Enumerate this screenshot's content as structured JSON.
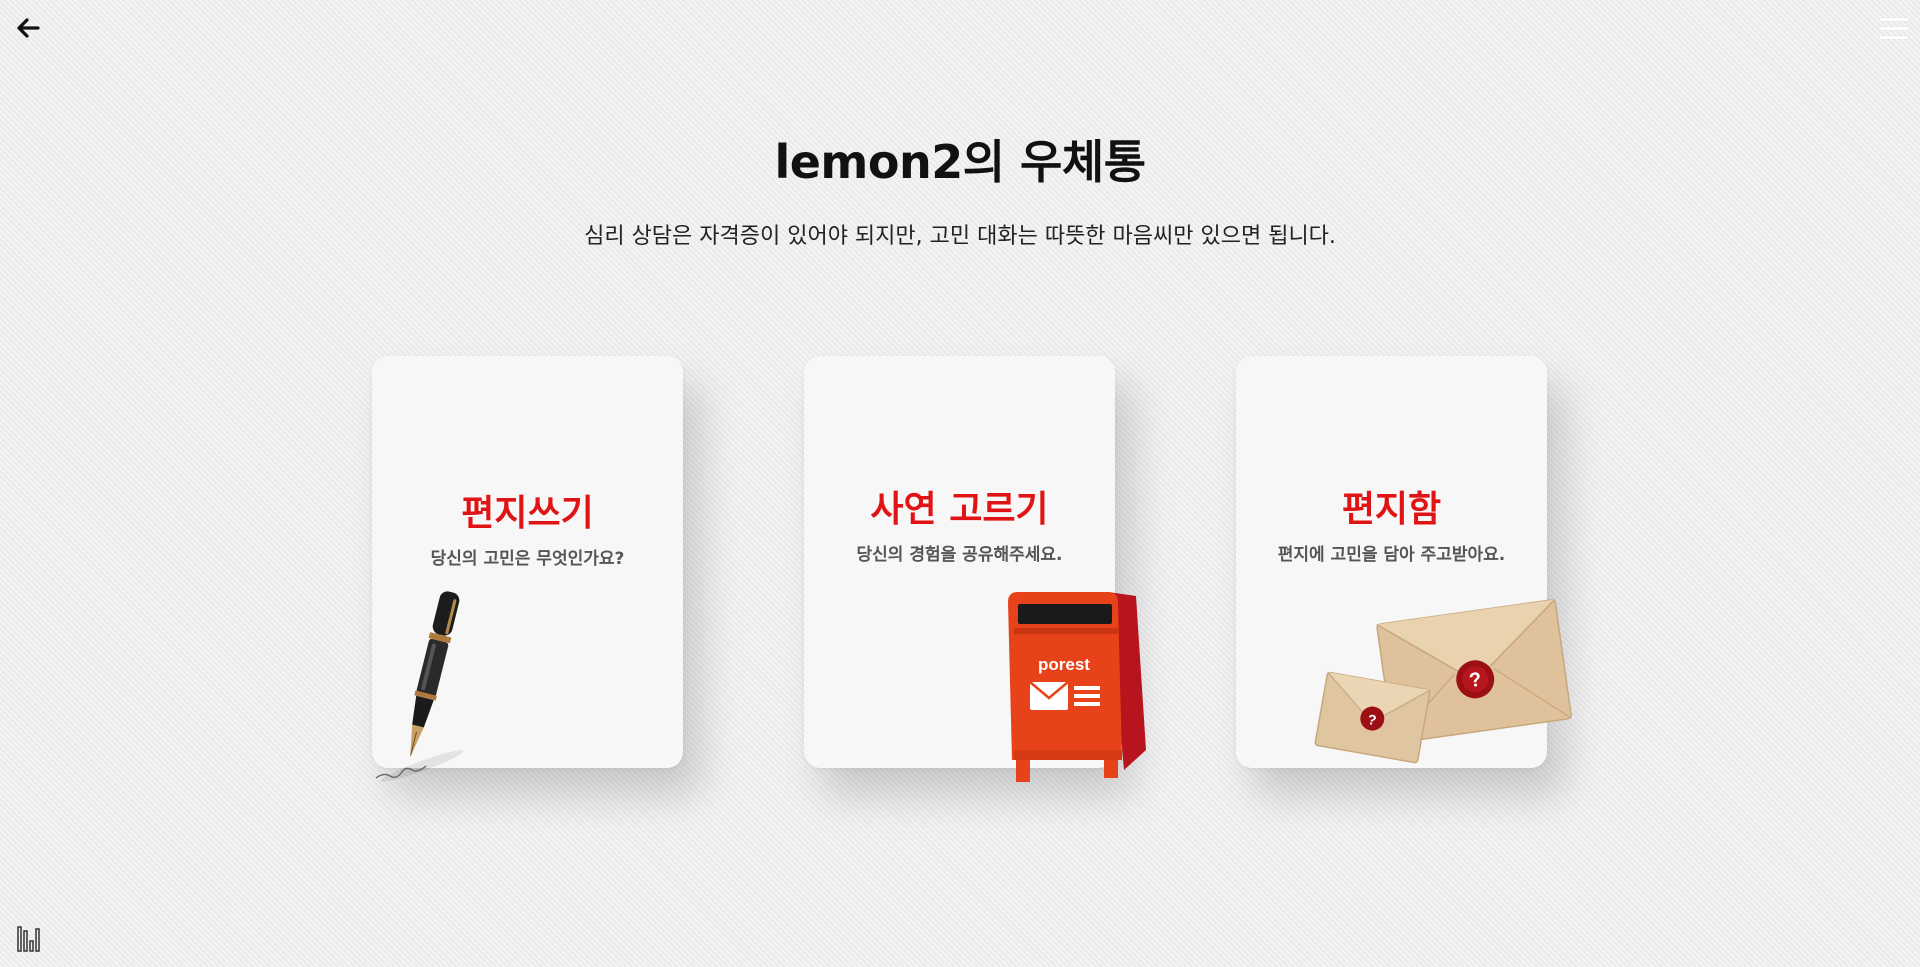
{
  "header": {
    "back_icon": "arrow-left-icon",
    "menu_icon": "hamburger-menu-icon"
  },
  "page": {
    "title": "lemon2의 우체통",
    "subtitle": "심리 상담은 자격증이 있어야 되지만, 고민 대화는 따뜻한 마음씨만 있으면 됩니다."
  },
  "cards": [
    {
      "title": "편지쓰기",
      "description": "당신의 고민은 무엇인가요?",
      "icon": "fountain-pen-icon"
    },
    {
      "title": "사연 고르기",
      "description": "당신의 경험을 공유해주세요.",
      "icon": "mailbox-icon",
      "mailbox_label": "porest"
    },
    {
      "title": "편지함",
      "description": "편지에 고민을 담아 주고받아요.",
      "icon": "envelopes-icon",
      "seal_mark": "?"
    }
  ],
  "colors": {
    "accent": "#e01414",
    "background": "#eeeef0",
    "card": "#f7f7f7",
    "mailbox": "#e8421a"
  },
  "footer": {
    "icon": "audio-bars-icon"
  }
}
